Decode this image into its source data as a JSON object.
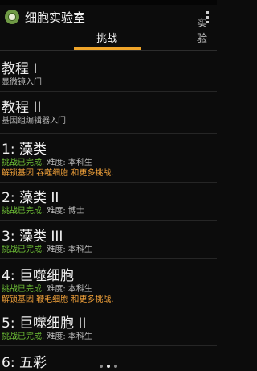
{
  "app": {
    "title": "细胞实验室"
  },
  "tabs": [
    "挑战",
    "实验"
  ],
  "items": [
    {
      "title": "教程 I",
      "lines": [
        {
          "parts": [
            {
              "t": "显微镜入门",
              "c": "gray"
            }
          ]
        }
      ]
    },
    {
      "title": "教程 II",
      "lines": [
        {
          "parts": [
            {
              "t": "基因组编辑器入门",
              "c": "gray"
            }
          ]
        }
      ]
    },
    {
      "title": "1: 藻类",
      "lines": [
        {
          "parts": [
            {
              "t": "挑战已完成.",
              "c": "green"
            },
            {
              "t": " 难度: 本科生",
              "c": "gray"
            }
          ]
        },
        {
          "parts": [
            {
              "t": "解锁基因 吞噬细胞 和更多挑战.",
              "c": "orange"
            }
          ]
        }
      ]
    },
    {
      "title": "2: 藻类 II",
      "lines": [
        {
          "parts": [
            {
              "t": "挑战已完成.",
              "c": "green"
            },
            {
              "t": " 难度: 博士",
              "c": "gray"
            }
          ]
        }
      ]
    },
    {
      "title": "3: 藻类 III",
      "lines": [
        {
          "parts": [
            {
              "t": "挑战已完成.",
              "c": "green"
            },
            {
              "t": " 难度: 本科生",
              "c": "gray"
            }
          ]
        }
      ]
    },
    {
      "title": "4: 巨噬细胞",
      "lines": [
        {
          "parts": [
            {
              "t": "挑战已完成.",
              "c": "green"
            },
            {
              "t": " 难度: 本科生",
              "c": "gray"
            }
          ]
        },
        {
          "parts": [
            {
              "t": "解锁基因 鞭毛细胞 和更多挑战.",
              "c": "orange"
            }
          ]
        }
      ]
    },
    {
      "title": "5: 巨噬细胞 II",
      "lines": [
        {
          "parts": [
            {
              "t": "挑战已完成.",
              "c": "green"
            },
            {
              "t": " 难度: 本科生",
              "c": "gray"
            }
          ]
        }
      ]
    },
    {
      "title": "6: 五彩",
      "lines": []
    }
  ],
  "pager": {
    "count": 3,
    "active": 1
  }
}
